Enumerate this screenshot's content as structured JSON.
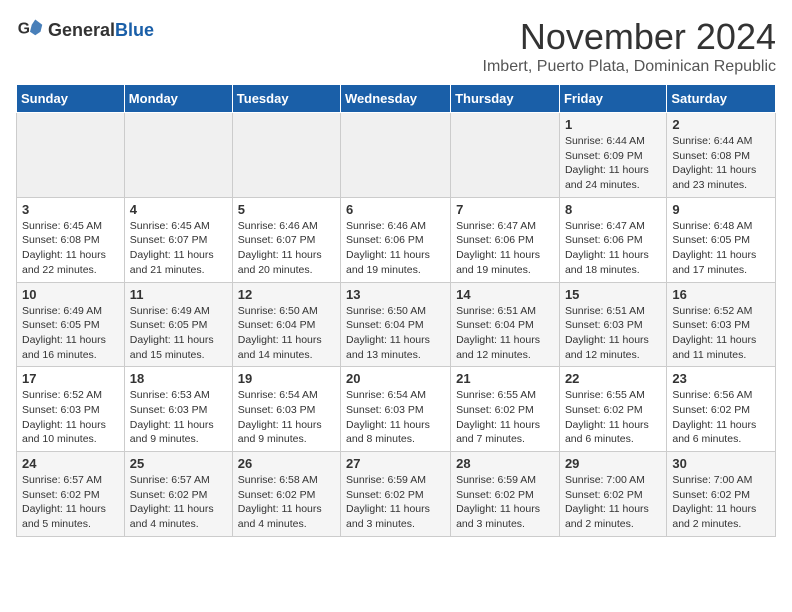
{
  "header": {
    "logo": {
      "general": "General",
      "blue": "Blue"
    },
    "title": "November 2024",
    "location": "Imbert, Puerto Plata, Dominican Republic"
  },
  "days_of_week": [
    "Sunday",
    "Monday",
    "Tuesday",
    "Wednesday",
    "Thursday",
    "Friday",
    "Saturday"
  ],
  "weeks": [
    [
      {
        "day": "",
        "info": ""
      },
      {
        "day": "",
        "info": ""
      },
      {
        "day": "",
        "info": ""
      },
      {
        "day": "",
        "info": ""
      },
      {
        "day": "",
        "info": ""
      },
      {
        "day": "1",
        "info": "Sunrise: 6:44 AM\nSunset: 6:09 PM\nDaylight: 11 hours and 24 minutes."
      },
      {
        "day": "2",
        "info": "Sunrise: 6:44 AM\nSunset: 6:08 PM\nDaylight: 11 hours and 23 minutes."
      }
    ],
    [
      {
        "day": "3",
        "info": "Sunrise: 6:45 AM\nSunset: 6:08 PM\nDaylight: 11 hours and 22 minutes."
      },
      {
        "day": "4",
        "info": "Sunrise: 6:45 AM\nSunset: 6:07 PM\nDaylight: 11 hours and 21 minutes."
      },
      {
        "day": "5",
        "info": "Sunrise: 6:46 AM\nSunset: 6:07 PM\nDaylight: 11 hours and 20 minutes."
      },
      {
        "day": "6",
        "info": "Sunrise: 6:46 AM\nSunset: 6:06 PM\nDaylight: 11 hours and 19 minutes."
      },
      {
        "day": "7",
        "info": "Sunrise: 6:47 AM\nSunset: 6:06 PM\nDaylight: 11 hours and 19 minutes."
      },
      {
        "day": "8",
        "info": "Sunrise: 6:47 AM\nSunset: 6:06 PM\nDaylight: 11 hours and 18 minutes."
      },
      {
        "day": "9",
        "info": "Sunrise: 6:48 AM\nSunset: 6:05 PM\nDaylight: 11 hours and 17 minutes."
      }
    ],
    [
      {
        "day": "10",
        "info": "Sunrise: 6:49 AM\nSunset: 6:05 PM\nDaylight: 11 hours and 16 minutes."
      },
      {
        "day": "11",
        "info": "Sunrise: 6:49 AM\nSunset: 6:05 PM\nDaylight: 11 hours and 15 minutes."
      },
      {
        "day": "12",
        "info": "Sunrise: 6:50 AM\nSunset: 6:04 PM\nDaylight: 11 hours and 14 minutes."
      },
      {
        "day": "13",
        "info": "Sunrise: 6:50 AM\nSunset: 6:04 PM\nDaylight: 11 hours and 13 minutes."
      },
      {
        "day": "14",
        "info": "Sunrise: 6:51 AM\nSunset: 6:04 PM\nDaylight: 11 hours and 12 minutes."
      },
      {
        "day": "15",
        "info": "Sunrise: 6:51 AM\nSunset: 6:03 PM\nDaylight: 11 hours and 12 minutes."
      },
      {
        "day": "16",
        "info": "Sunrise: 6:52 AM\nSunset: 6:03 PM\nDaylight: 11 hours and 11 minutes."
      }
    ],
    [
      {
        "day": "17",
        "info": "Sunrise: 6:52 AM\nSunset: 6:03 PM\nDaylight: 11 hours and 10 minutes."
      },
      {
        "day": "18",
        "info": "Sunrise: 6:53 AM\nSunset: 6:03 PM\nDaylight: 11 hours and 9 minutes."
      },
      {
        "day": "19",
        "info": "Sunrise: 6:54 AM\nSunset: 6:03 PM\nDaylight: 11 hours and 9 minutes."
      },
      {
        "day": "20",
        "info": "Sunrise: 6:54 AM\nSunset: 6:03 PM\nDaylight: 11 hours and 8 minutes."
      },
      {
        "day": "21",
        "info": "Sunrise: 6:55 AM\nSunset: 6:02 PM\nDaylight: 11 hours and 7 minutes."
      },
      {
        "day": "22",
        "info": "Sunrise: 6:55 AM\nSunset: 6:02 PM\nDaylight: 11 hours and 6 minutes."
      },
      {
        "day": "23",
        "info": "Sunrise: 6:56 AM\nSunset: 6:02 PM\nDaylight: 11 hours and 6 minutes."
      }
    ],
    [
      {
        "day": "24",
        "info": "Sunrise: 6:57 AM\nSunset: 6:02 PM\nDaylight: 11 hours and 5 minutes."
      },
      {
        "day": "25",
        "info": "Sunrise: 6:57 AM\nSunset: 6:02 PM\nDaylight: 11 hours and 4 minutes."
      },
      {
        "day": "26",
        "info": "Sunrise: 6:58 AM\nSunset: 6:02 PM\nDaylight: 11 hours and 4 minutes."
      },
      {
        "day": "27",
        "info": "Sunrise: 6:59 AM\nSunset: 6:02 PM\nDaylight: 11 hours and 3 minutes."
      },
      {
        "day": "28",
        "info": "Sunrise: 6:59 AM\nSunset: 6:02 PM\nDaylight: 11 hours and 3 minutes."
      },
      {
        "day": "29",
        "info": "Sunrise: 7:00 AM\nSunset: 6:02 PM\nDaylight: 11 hours and 2 minutes."
      },
      {
        "day": "30",
        "info": "Sunrise: 7:00 AM\nSunset: 6:02 PM\nDaylight: 11 hours and 2 minutes."
      }
    ]
  ]
}
